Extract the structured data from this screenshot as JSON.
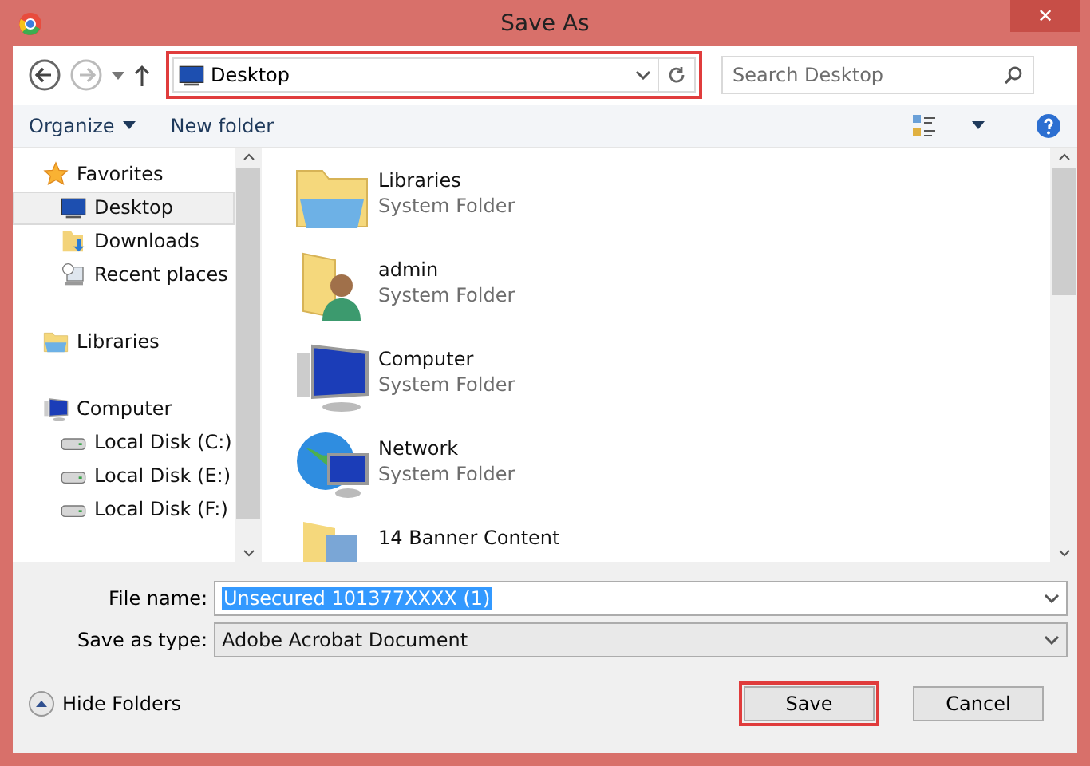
{
  "window": {
    "title": "Save As",
    "close": "✕"
  },
  "nav": {
    "address": "Desktop",
    "address_highlighted": true,
    "search": {
      "placeholder": "Search Desktop"
    }
  },
  "toolbar": {
    "organize": "Organize",
    "new_folder": "New folder"
  },
  "sidebar": {
    "groups": [
      {
        "label": "Favorites",
        "children": [
          {
            "label": "Desktop",
            "selected": true
          },
          {
            "label": "Downloads",
            "selected": false
          },
          {
            "label": "Recent places",
            "selected": false
          }
        ]
      },
      {
        "label": "Libraries"
      },
      {
        "label": "Computer",
        "children": [
          {
            "label": "Local Disk (C:)",
            "selected": false
          },
          {
            "label": "Local Disk (E:)",
            "selected": false
          },
          {
            "label": "Local Disk (F:)",
            "selected": false
          }
        ]
      }
    ]
  },
  "files": [
    {
      "name": "Libraries",
      "type": "System Folder"
    },
    {
      "name": "admin",
      "type": "System Folder"
    },
    {
      "name": "Computer",
      "type": "System Folder"
    },
    {
      "name": "Network",
      "type": "System Folder"
    },
    {
      "name": "14 Banner  Content"
    }
  ],
  "form": {
    "file_name_label": "File name:",
    "file_name": "Unsecured 101377XXXX (1)",
    "type_label": "Save as type:",
    "type": "Adobe Acrobat Document"
  },
  "footer": {
    "hide_folders": "Hide Folders",
    "buttons": [
      {
        "label": "Save",
        "highlighted": true
      },
      {
        "label": "Cancel",
        "highlighted": false
      }
    ]
  }
}
